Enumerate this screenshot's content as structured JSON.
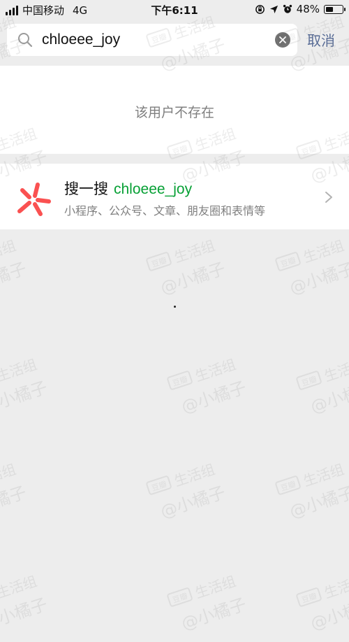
{
  "status_bar": {
    "carrier": "中国移动",
    "network": "4G",
    "time": "下午6:11",
    "battery": "48%",
    "battery_level": 0.48
  },
  "search": {
    "query": "chloeee_joy",
    "cancel_label": "取消"
  },
  "result": {
    "message": "该用户不存在"
  },
  "search_one": {
    "title": "搜一搜",
    "keyword": "chloeee_joy",
    "subtitle": "小程序、公众号、文章、朋友圈和表情等",
    "accent_color": "#fa5151"
  },
  "watermark": {
    "badge": "豆瓣",
    "line1": "生活组",
    "line2": "@小橘子"
  },
  "colors": {
    "background": "#ededed",
    "link": "#576b95",
    "keyword": "#07a035",
    "muted": "#7f7f7f"
  }
}
